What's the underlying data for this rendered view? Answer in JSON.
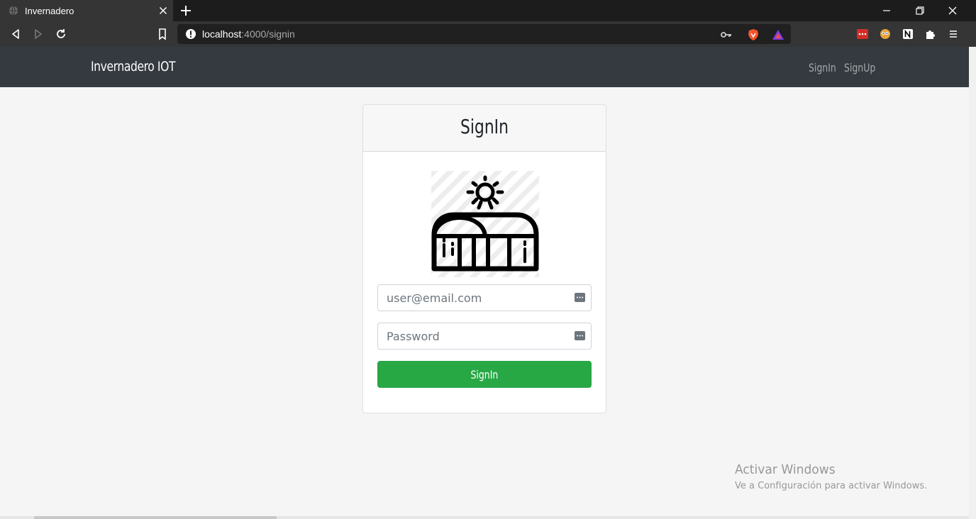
{
  "browser": {
    "tab_title": "Invernadero",
    "url_host": "localhost",
    "url_path": ":4000/signin"
  },
  "navbar": {
    "brand": "Invernadero IOT",
    "links": [
      "SignIn",
      "SignUp"
    ]
  },
  "signin_card": {
    "title": "SignIn",
    "email_placeholder": "user@email.com",
    "password_placeholder": "Password",
    "submit_label": "SignIn"
  },
  "watermark": {
    "title": "Activar Windows",
    "subtitle": "Ve a Configuración para activar Windows."
  },
  "colors": {
    "navbar_bg": "#343a40",
    "submit_bg": "#28a745",
    "page_bg": "#f5f5f5"
  },
  "icons": {
    "logo": "greenhouse-sun-icon",
    "field_addon": "password-manager-icon"
  }
}
